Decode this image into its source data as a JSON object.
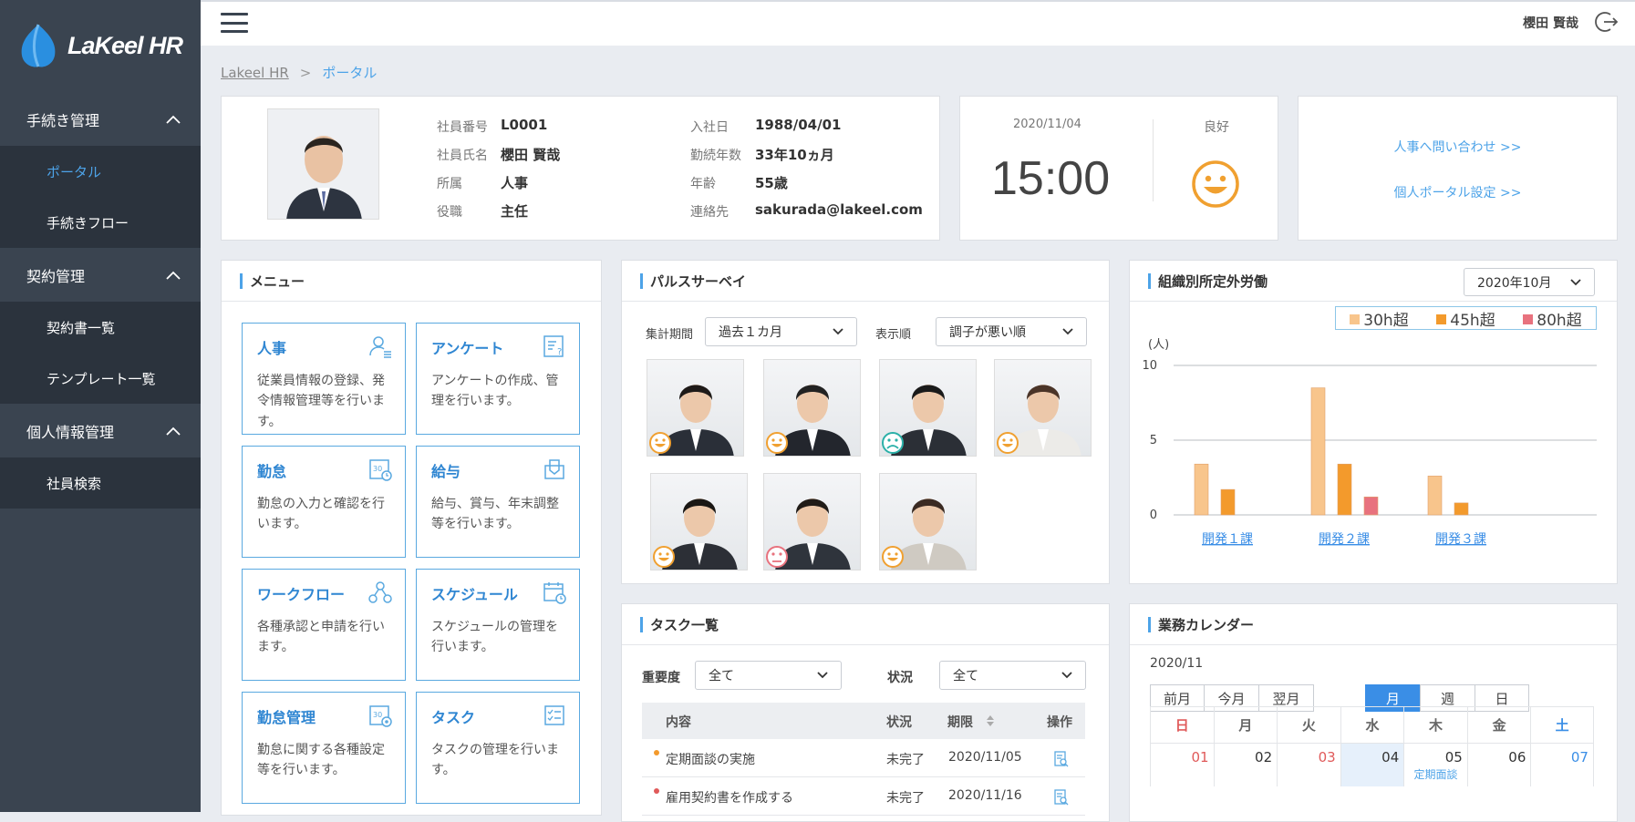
{
  "app": {
    "brand": "LaKeel HR",
    "user_name": "櫻田 賢哉"
  },
  "sidebar": {
    "groups": [
      {
        "label": "手続き管理",
        "items": [
          {
            "label": "ポータル"
          },
          {
            "label": "手続きフロー"
          }
        ]
      },
      {
        "label": "契約管理",
        "items": [
          {
            "label": "契約書一覧"
          },
          {
            "label": "テンプレート一覧"
          }
        ]
      },
      {
        "label": "個人情報管理",
        "items": [
          {
            "label": "社員検索"
          }
        ]
      }
    ]
  },
  "breadcrumb": {
    "home": "Lakeel HR",
    "separator": ">",
    "current": "ポータル"
  },
  "profile": {
    "fields": [
      {
        "label": "社員番号",
        "value": "L0001"
      },
      {
        "label": "社員氏名",
        "value": "櫻田 賢哉"
      },
      {
        "label": "所属",
        "value": "人事"
      },
      {
        "label": "役職",
        "value": "主任"
      },
      {
        "label": "入社日",
        "value": "1988/04/01"
      },
      {
        "label": "勤続年数",
        "value": "33年10ヵ月"
      },
      {
        "label": "年齢",
        "value": "55歳"
      },
      {
        "label": "連絡先",
        "value": "sakurada@lakeel.com"
      }
    ]
  },
  "clock": {
    "date": "2020/11/04",
    "time": "15:00",
    "mood_label": "良好"
  },
  "links": {
    "inquiry": "人事へ問い合わせ >>",
    "settings": "個人ポータル設定 >>"
  },
  "menu": {
    "title": "メニュー",
    "tiles": [
      {
        "title": "人事",
        "desc": "従業員情報の登録、発令情報管理等を行います。",
        "icon": "person-list-icon"
      },
      {
        "title": "アンケート",
        "desc": "アンケートの作成、管理を行います。",
        "icon": "survey-icon"
      },
      {
        "title": "勤怠",
        "desc": "勤怠の入力と確認を行います。",
        "icon": "attendance-calendar-icon"
      },
      {
        "title": "給与",
        "desc": "給与、賞与、年末調整等を行います。",
        "icon": "payslip-icon"
      },
      {
        "title": "ワークフロー",
        "desc": "各種承認と申請を行います。",
        "icon": "workflow-icon"
      },
      {
        "title": "スケジュール",
        "desc": "スケジュールの管理を行います。",
        "icon": "schedule-icon"
      },
      {
        "title": "勤怠管理",
        "desc": "勤怠に関する各種設定等を行います。",
        "icon": "attendance-settings-icon"
      },
      {
        "title": "タスク",
        "desc": "タスクの管理を行います。",
        "icon": "task-checklist-icon"
      }
    ]
  },
  "pulse": {
    "title": "パルスサーベイ",
    "period_label": "集計期間",
    "period_value": "過去１カ月",
    "order_label": "表示順",
    "order_value": "調子が悪い順",
    "faces": [
      {
        "mood": "good"
      },
      {
        "mood": "good"
      },
      {
        "mood": "bad"
      },
      {
        "mood": "good"
      },
      {
        "mood": "good"
      },
      {
        "mood": "poor"
      },
      {
        "mood": "good"
      }
    ]
  },
  "overtime": {
    "title": "組織別所定外労働",
    "month_value": "2020年10月"
  },
  "chart_data": {
    "type": "bar",
    "categories": [
      "開発１課",
      "開発２課",
      "開発３課"
    ],
    "series": [
      {
        "name": "30h超",
        "values": [
          3.4,
          8.5,
          2.6
        ],
        "color": "#f8c58c"
      },
      {
        "name": "45h超",
        "values": [
          1.7,
          3.4,
          0.8
        ],
        "color": "#f39a2c"
      },
      {
        "name": "80h超",
        "values": [
          0,
          1.2,
          0
        ],
        "color": "#e8727e"
      }
    ],
    "ylabel": "(人)",
    "ylim": [
      0,
      10
    ],
    "yticks": [
      0,
      5,
      10
    ],
    "legend": "top-right"
  },
  "tasks": {
    "title": "タスク一覧",
    "priority_label": "重要度",
    "priority_value": "全て",
    "status_label": "状況",
    "status_value": "全て",
    "columns": [
      "内容",
      "状況",
      "期限",
      "操作"
    ],
    "rows": [
      {
        "content": "定期面談の実施",
        "status": "未完了",
        "due": "2020/11/05",
        "dot_color": "#f39a2c"
      },
      {
        "content": "雇用契約書を作成する",
        "status": "未完了",
        "due": "2020/11/16",
        "dot_color": "#e05a5a"
      }
    ]
  },
  "calendar": {
    "title": "業務カレンダー",
    "month": "2020/11",
    "nav": [
      "前月",
      "今月",
      "翌月"
    ],
    "views": [
      "月",
      "週",
      "日"
    ],
    "weekdays": [
      "日",
      "月",
      "火",
      "水",
      "木",
      "金",
      "土"
    ],
    "week1": [
      {
        "day": "01"
      },
      {
        "day": "02"
      },
      {
        "day": "03"
      },
      {
        "day": "04"
      },
      {
        "day": "05",
        "event": "定期面談"
      },
      {
        "day": "06"
      },
      {
        "day": "07"
      }
    ]
  }
}
